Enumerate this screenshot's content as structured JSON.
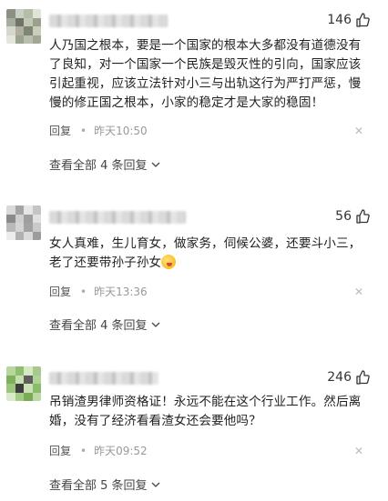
{
  "comments": [
    {
      "likes": "146",
      "text": "人乃国之根本，要是一个国家的根本大多都没有道德没有了良知，对一个国家一个民族是毁灭性的引向，国家应该引起重视，应该立法针对小三与出轨这行为严打严惩，慢慢的修正国之根本，小家的稳定才是大家的稳固！",
      "reply_label": "回复",
      "time": "昨天10:50",
      "view_all": "查看全部 4 条回复"
    },
    {
      "likes": "56",
      "text_line1": "女人真难，生儿育女，做家务，伺候公婆，还要斗小三，",
      "text_line2": "老了还要带孙子孙女",
      "reply_label": "回复",
      "time": "昨天13:36",
      "view_all": "查看全部 4 条回复"
    },
    {
      "likes": "246",
      "text": "吊销渣男律师资格证！永远不能在这个行业工作。然后离婚，没有了经济看看渣女还会要他吗？",
      "reply_label": "回复",
      "time": "昨天09:52",
      "view_all": "查看全部 5 条回复"
    }
  ],
  "icons": {
    "like": "thumbs-up-icon",
    "close": "close-icon",
    "chevron": "chevron-down-icon"
  }
}
